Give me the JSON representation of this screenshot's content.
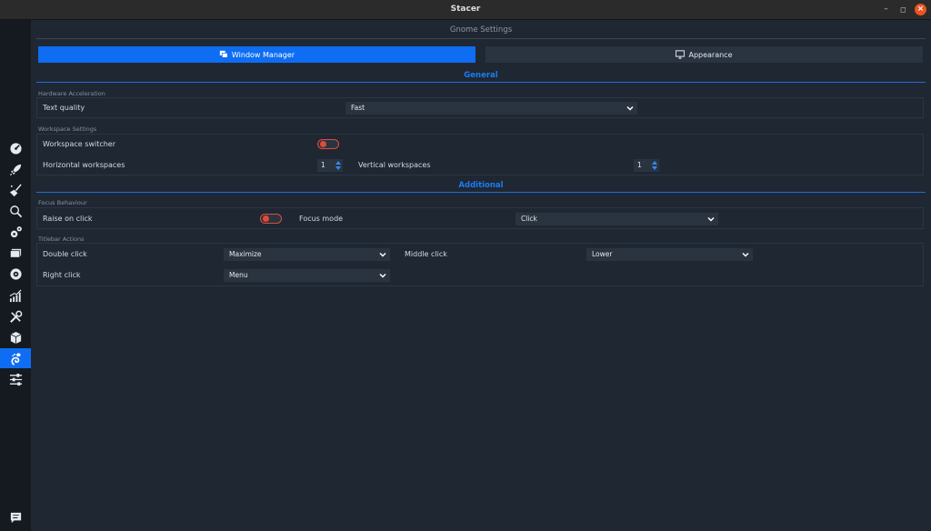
{
  "window": {
    "title": "Stacer",
    "min_glyph": "–",
    "max_glyph": "◻",
    "close_glyph": "×"
  },
  "sidebar": {
    "items": [
      {
        "icon": "dashboard-icon"
      },
      {
        "icon": "rocket-icon"
      },
      {
        "icon": "broom-icon"
      },
      {
        "icon": "search-icon"
      },
      {
        "icon": "gears-icon"
      },
      {
        "icon": "processes-icon"
      },
      {
        "icon": "uninstaller-icon"
      },
      {
        "icon": "resources-icon"
      },
      {
        "icon": "tools-icon"
      },
      {
        "icon": "apt-repository-icon"
      },
      {
        "icon": "gnome-settings-icon",
        "active": true
      },
      {
        "icon": "settings-sliders-icon"
      }
    ],
    "feedback_icon": "feedback-icon"
  },
  "page": {
    "title": "Gnome Settings"
  },
  "tabs": [
    {
      "label": "Window Manager",
      "icon": "windows-icon",
      "active": true
    },
    {
      "label": "Appearance",
      "icon": "monitor-icon",
      "active": false
    }
  ],
  "general": {
    "heading": "General",
    "hardware": {
      "group_label": "Hardware Acceleration",
      "text_quality_label": "Text quality",
      "text_quality_value": "Fast"
    },
    "workspace": {
      "group_label": "Workspace Settings",
      "switcher_label": "Workspace switcher",
      "switcher_on": false,
      "horizontal_label": "Horizontal workspaces",
      "horizontal_value": "1",
      "vertical_label": "Vertical workspaces",
      "vertical_value": "1"
    }
  },
  "additional": {
    "heading": "Additional",
    "focus": {
      "group_label": "Focus Behaviour",
      "raise_label": "Raise on click",
      "raise_on": false,
      "focus_mode_label": "Focus mode",
      "focus_mode_value": "Click"
    },
    "titlebar": {
      "group_label": "Titlebar Actions",
      "double_click_label": "Double click",
      "double_click_value": "Maximize",
      "middle_click_label": "Middle click",
      "middle_click_value": "Lower",
      "right_click_label": "Right click",
      "right_click_value": "Menu"
    }
  },
  "colors": {
    "accent": "#0e6df2",
    "toggle_off": "#e04a3b",
    "background": "#1f2733",
    "sidebar": "#151a21"
  }
}
